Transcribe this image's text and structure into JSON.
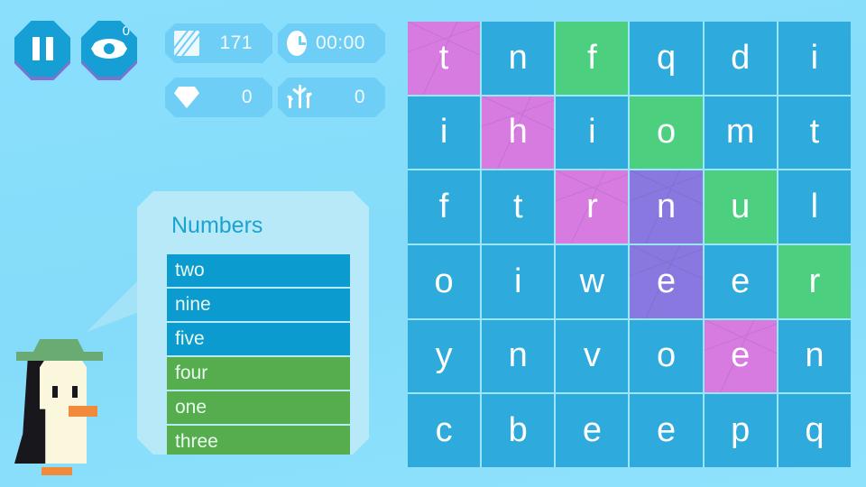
{
  "hud": {
    "pause_button": {
      "label": "",
      "icon": "pause-icon"
    },
    "hint_button": {
      "icon": "eye-icon",
      "badge": "0"
    },
    "stats": [
      {
        "icon": "ice-block-icon",
        "name": "ice",
        "value": "171"
      },
      {
        "icon": "clock-icon",
        "name": "timer",
        "value": "00:00"
      },
      {
        "icon": "gem-icon",
        "name": "gems",
        "value": "0"
      },
      {
        "icon": "coral-icon",
        "name": "coral",
        "value": "0"
      }
    ]
  },
  "word_panel": {
    "title": "Numbers",
    "words": [
      {
        "text": "two",
        "found": false
      },
      {
        "text": "nine",
        "found": false
      },
      {
        "text": "five",
        "found": false
      },
      {
        "text": "four",
        "found": true
      },
      {
        "text": "one",
        "found": true
      },
      {
        "text": "three",
        "found": true
      }
    ]
  },
  "grid": {
    "rows": 6,
    "cols": 6,
    "cells": [
      [
        {
          "l": "t",
          "s": "pink"
        },
        {
          "l": "n",
          "s": "base"
        },
        {
          "l": "f",
          "s": "green"
        },
        {
          "l": "q",
          "s": "base"
        },
        {
          "l": "d",
          "s": "base"
        },
        {
          "l": "i",
          "s": "base"
        }
      ],
      [
        {
          "l": "i",
          "s": "base"
        },
        {
          "l": "h",
          "s": "pink"
        },
        {
          "l": "i",
          "s": "base"
        },
        {
          "l": "o",
          "s": "green"
        },
        {
          "l": "m",
          "s": "base"
        },
        {
          "l": "t",
          "s": "base"
        }
      ],
      [
        {
          "l": "f",
          "s": "base"
        },
        {
          "l": "t",
          "s": "base"
        },
        {
          "l": "r",
          "s": "pink"
        },
        {
          "l": "n",
          "s": "purple"
        },
        {
          "l": "u",
          "s": "green"
        },
        {
          "l": "l",
          "s": "base"
        }
      ],
      [
        {
          "l": "o",
          "s": "base"
        },
        {
          "l": "i",
          "s": "base"
        },
        {
          "l": "w",
          "s": "base"
        },
        {
          "l": "e",
          "s": "purple"
        },
        {
          "l": "e",
          "s": "base"
        },
        {
          "l": "r",
          "s": "green"
        }
      ],
      [
        {
          "l": "y",
          "s": "base"
        },
        {
          "l": "n",
          "s": "base"
        },
        {
          "l": "v",
          "s": "base"
        },
        {
          "l": "o",
          "s": "base"
        },
        {
          "l": "e",
          "s": "pink"
        },
        {
          "l": "n",
          "s": "base"
        }
      ],
      [
        {
          "l": "c",
          "s": "base"
        },
        {
          "l": "b",
          "s": "base"
        },
        {
          "l": "e",
          "s": "base"
        },
        {
          "l": "e",
          "s": "base"
        },
        {
          "l": "p",
          "s": "base"
        },
        {
          "l": "q",
          "s": "base"
        }
      ]
    ]
  },
  "colors": {
    "background": "#87ddfb",
    "cell_base": "#2eabdc",
    "cell_green": "#4cd080",
    "cell_pink": "#d77be0",
    "cell_purple": "#8878e0",
    "word_pending": "#0b9bce",
    "word_found": "#55ad4d",
    "panel": "#b8e9f8",
    "title": "#1ba3d0",
    "button": "#169fd4",
    "button_shadow": "#7b74cf",
    "pill": "#6ecef5"
  }
}
